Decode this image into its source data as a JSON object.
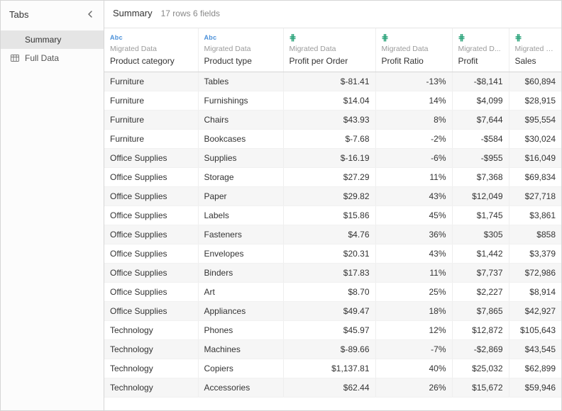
{
  "sidebar": {
    "title": "Tabs",
    "items": [
      {
        "label": "Summary",
        "active": true,
        "icon": "none"
      },
      {
        "label": "Full Data",
        "active": false,
        "icon": "table"
      }
    ]
  },
  "header": {
    "title": "Summary",
    "meta": "17 rows  6 fields"
  },
  "columns": [
    {
      "type": "Abc",
      "type_display": "Abc",
      "source": "Migrated Data",
      "name": "Product category",
      "align": "left"
    },
    {
      "type": "Abc",
      "type_display": "Abc",
      "source": "Migrated Data",
      "name": "Product type",
      "align": "left"
    },
    {
      "type": "#",
      "type_display": "⋕",
      "source": "Migrated Data",
      "name": "Profit per Order",
      "align": "right"
    },
    {
      "type": "#",
      "type_display": "⋕",
      "source": "Migrated Data",
      "name": "Profit Ratio",
      "align": "right"
    },
    {
      "type": "#",
      "type_display": "⋕",
      "source": "Migrated D...",
      "name": "Profit",
      "align": "right"
    },
    {
      "type": "#",
      "type_display": "⋕",
      "source": "Migrated D...",
      "name": "Sales",
      "align": "right"
    }
  ],
  "rows": [
    [
      "Furniture",
      "Tables",
      "$-81.41",
      "-13%",
      "-$8,141",
      "$60,894"
    ],
    [
      "Furniture",
      "Furnishings",
      "$14.04",
      "14%",
      "$4,099",
      "$28,915"
    ],
    [
      "Furniture",
      "Chairs",
      "$43.93",
      "8%",
      "$7,644",
      "$95,554"
    ],
    [
      "Furniture",
      "Bookcases",
      "$-7.68",
      "-2%",
      "-$584",
      "$30,024"
    ],
    [
      "Office Supplies",
      "Supplies",
      "$-16.19",
      "-6%",
      "-$955",
      "$16,049"
    ],
    [
      "Office Supplies",
      "Storage",
      "$27.29",
      "11%",
      "$7,368",
      "$69,834"
    ],
    [
      "Office Supplies",
      "Paper",
      "$29.82",
      "43%",
      "$12,049",
      "$27,718"
    ],
    [
      "Office Supplies",
      "Labels",
      "$15.86",
      "45%",
      "$1,745",
      "$3,861"
    ],
    [
      "Office Supplies",
      "Fasteners",
      "$4.76",
      "36%",
      "$305",
      "$858"
    ],
    [
      "Office Supplies",
      "Envelopes",
      "$20.31",
      "43%",
      "$1,442",
      "$3,379"
    ],
    [
      "Office Supplies",
      "Binders",
      "$17.83",
      "11%",
      "$7,737",
      "$72,986"
    ],
    [
      "Office Supplies",
      "Art",
      "$8.70",
      "25%",
      "$2,227",
      "$8,914"
    ],
    [
      "Office Supplies",
      "Appliances",
      "$49.47",
      "18%",
      "$7,865",
      "$42,927"
    ],
    [
      "Technology",
      "Phones",
      "$45.97",
      "12%",
      "$12,872",
      "$105,643"
    ],
    [
      "Technology",
      "Machines",
      "$-89.66",
      "-7%",
      "-$2,869",
      "$43,545"
    ],
    [
      "Technology",
      "Copiers",
      "$1,137.81",
      "40%",
      "$25,032",
      "$62,899"
    ],
    [
      "Technology",
      "Accessories",
      "$62.44",
      "26%",
      "$15,672",
      "$59,946"
    ]
  ]
}
